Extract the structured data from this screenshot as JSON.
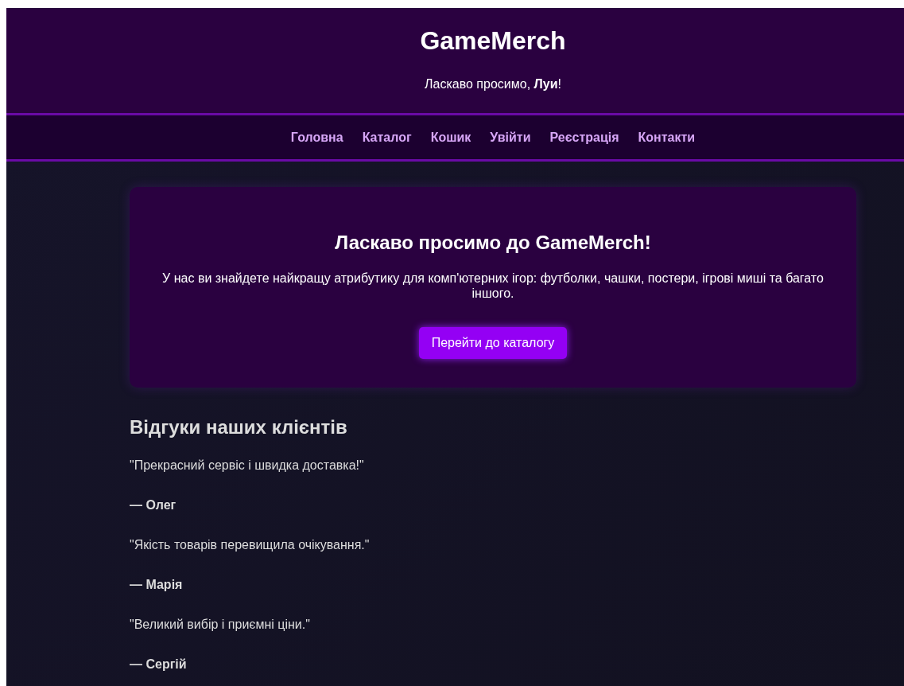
{
  "header": {
    "title": "GameMerch",
    "greeting": "Ласкаво просимо, **Луи**!"
  },
  "nav": [
    {
      "label": "Головна"
    },
    {
      "label": "Каталог"
    },
    {
      "label": "Кошик"
    },
    {
      "label": "Увійти"
    },
    {
      "label": "Реєстрація"
    },
    {
      "label": "Контакти"
    }
  ],
  "hero": {
    "title": "Ласкаво просимо до GameMerch!",
    "text": "У нас ви знайдете найкращу атрибутику для комп'ютерних ігор: футболки, чашки, постери, ігрові миші та багато іншого.",
    "button": "Перейти до каталогу"
  },
  "reviews": {
    "title": "Відгуки наших клієнтів",
    "items": [
      {
        "quote": "\"Прекрасний сервіс і швидка доставка!\"",
        "author": "— Олег"
      },
      {
        "quote": "\"Якість товарів перевищила очікування.\"",
        "author": "— Марія"
      },
      {
        "quote": "\"Великий вибір і приємні ціни.\"",
        "author": "— Сергій"
      }
    ]
  }
}
